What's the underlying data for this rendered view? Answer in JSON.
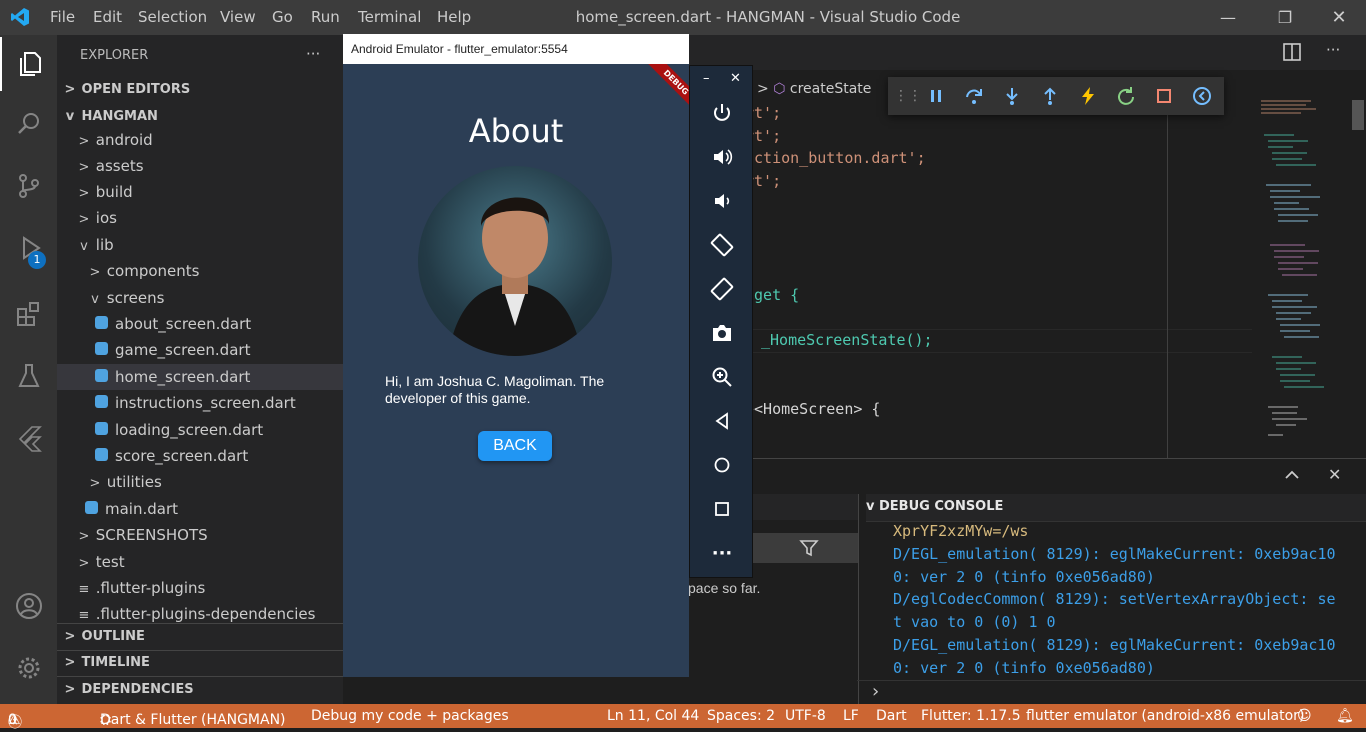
{
  "titlebar": {
    "menu": [
      "File",
      "Edit",
      "Selection",
      "View",
      "Go",
      "Run",
      "Terminal",
      "Help"
    ],
    "window_title": "home_screen.dart - HANGMAN - Visual Studio Code",
    "minimize": "—",
    "restore": "❐",
    "close": "✕"
  },
  "activity": {
    "debug_badge": "1"
  },
  "sidebar": {
    "header": "EXPLORER",
    "more": "···",
    "open_editors": "OPEN EDITORS",
    "project": "HANGMAN",
    "items": [
      "android",
      "assets",
      "build",
      "ios",
      "lib",
      "components",
      "screens",
      "about_screen.dart",
      "game_screen.dart",
      "home_screen.dart",
      "instructions_screen.dart",
      "loading_screen.dart",
      "score_screen.dart",
      "utilities",
      "main.dart",
      "SCREENSHOTS",
      "test",
      ".flutter-plugins",
      ".flutter-plugins-dependencies"
    ],
    "outline": "OUTLINE",
    "timeline": "TIMELINE",
    "dependencies": "DEPENDENCIES"
  },
  "editor": {
    "breadcrumb": "createState",
    "lines": [
      "rt';",
      "rt';",
      "action_button.dart';",
      "rt';",
      "dget {",
      "_HomeScreenState();",
      "e<HomeScreen> {"
    ],
    "brace": "{",
    "semicolon": ";",
    "lt_paren": "(",
    "paren_close": ")",
    "gt": ">"
  },
  "emulator": {
    "title": "Android Emulator - flutter_emulator:5554",
    "debug_banner": "DEBUG",
    "app_title": "About",
    "bio": "Hi, I am Joshua C. Magoliman. The developer of this game.",
    "button": "BACK",
    "min": "–",
    "close": "✕"
  },
  "panel": {
    "filter_text": "pace so far.",
    "console_title": "DEBUG CONSOLE",
    "console_lines": [
      "XprYF2xzMYw=/ws",
      "D/EGL_emulation( 8129): eglMakeCurrent: 0xeb9ac10",
      "0: ver 2 0 (tinfo 0xe056ad80)",
      "D/eglCodecCommon( 8129): setVertexArrayObject: se",
      "t vao to 0 (0) 1 0",
      "D/EGL_emulation( 8129): eglMakeCurrent: 0xeb9ac10",
      "0: ver 2 0 (tinfo 0xe056ad80)"
    ],
    "prompt": "›"
  },
  "statusbar": {
    "errors": "0",
    "warnings": "0",
    "project": "Dart & Flutter (HANGMAN)",
    "debug_mode": "Debug my code + packages",
    "position": "Ln 11, Col 44",
    "spaces": "Spaces: 2",
    "encoding": "UTF-8",
    "eol": "LF",
    "language": "Dart",
    "flutter": "Flutter: 1.17.5",
    "device": "flutter emulator (android-x86 emulator)"
  }
}
